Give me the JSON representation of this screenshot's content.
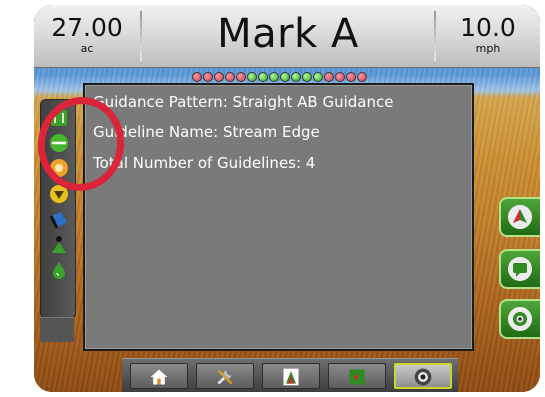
{
  "status_bar": {
    "area": {
      "value": "27.00",
      "unit": "ac"
    },
    "title": "Mark A",
    "speed": {
      "value": "10.0",
      "unit": "mph"
    }
  },
  "lightbar": {
    "dots": [
      "red",
      "red",
      "red",
      "red",
      "red",
      "green",
      "green",
      "green",
      "green",
      "green",
      "green",
      "green",
      "red",
      "red",
      "red",
      "red"
    ]
  },
  "info_panel": {
    "guidance_pattern": "Guidance Pattern: Straight AB Guidance",
    "guideline_name": "Guideline Name: Stream Edge",
    "total_guidelines": "Total Number of Guidelines: 4"
  },
  "left_toolbar": {
    "icons": [
      "guidance-mode-icon",
      "ab-line-icon",
      "pivot-mode-icon",
      "marker-icon",
      "camera-toggle-icon",
      "boundary-icon",
      "fuel-icon"
    ]
  },
  "right_toolbar": {
    "buttons": [
      "vehicle-view-icon",
      "field-view-icon",
      "camera-view-icon"
    ]
  },
  "bottom_toolbar": {
    "buttons": [
      "home-icon",
      "tools-icon",
      "guidance-view-icon",
      "map-view-icon",
      "camera-icon"
    ],
    "active": "camera-icon"
  },
  "colors": {
    "highlight_ring": "#d9243a",
    "button_green": "#2e8a21",
    "panel_gray": "#7a7a7a"
  }
}
